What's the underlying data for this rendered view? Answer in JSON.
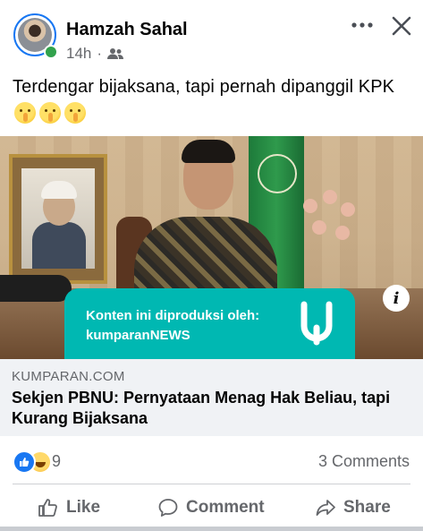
{
  "post": {
    "author": "Hamzah Sahal",
    "time": "14h",
    "separator": "·",
    "text": "Terdengar bijaksana, tapi pernah dipanggil KPK",
    "emojis": [
      "shushing-face-emoji",
      "shushing-face-emoji",
      "shushing-face-emoji"
    ]
  },
  "link": {
    "sponsor_line1": "Konten ini diproduksi oleh:",
    "sponsor_line2": "kumparanNEWS",
    "domain": "KUMPARAN.COM",
    "title": "Sekjen PBNU: Pernyataan Menag Hak Beliau, tapi Kurang Bijaksana"
  },
  "reactions": {
    "types": [
      "like",
      "haha"
    ],
    "count": "9",
    "comments": "3 Comments"
  },
  "actions": {
    "like": "Like",
    "comment": "Comment",
    "share": "Share"
  },
  "colors": {
    "facebook_blue": "#1877f2",
    "online_green": "#31a24c",
    "kumparan_teal": "#00b8b2",
    "secondary_text": "#65676b",
    "link_bg": "#f0f2f5"
  }
}
